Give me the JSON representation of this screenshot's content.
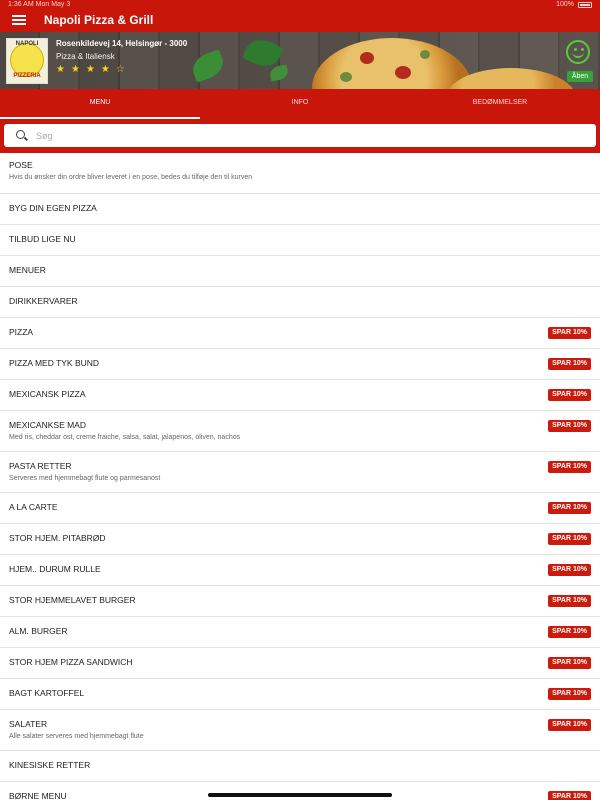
{
  "status_bar": {
    "time": "1:36 AM  Mon May 3",
    "battery": "100%"
  },
  "app_bar": {
    "title": "Napoli Pizza & Grill"
  },
  "restaurant": {
    "logo_text_top": "NAPOLI",
    "logo_text_bottom": "PIZZERIA",
    "address": "Rosenkildevej 14, Helsingør - 3000",
    "cuisine": "Pizza & Italiensk",
    "rating": {
      "filled": 4,
      "total": 5
    },
    "stars": [
      "★",
      "★",
      "★",
      "★",
      "☆"
    ],
    "status": "Åben"
  },
  "tabs": [
    {
      "label": "MENU",
      "active": true
    },
    {
      "label": "INFO",
      "active": false
    },
    {
      "label": "BEDØMMELSER",
      "active": false
    }
  ],
  "search": {
    "placeholder": "Søg"
  },
  "menu": [
    {
      "name": "POSE",
      "desc": "Hvis du ønsker din ordre bliver leveret i en pose, bedes du tilføje den til kurven",
      "badge": ""
    },
    {
      "name": "BYG DIN EGEN PIZZA",
      "desc": "",
      "badge": ""
    },
    {
      "name": "TILBUD LIGE NU",
      "desc": "",
      "badge": ""
    },
    {
      "name": "MENUER",
      "desc": "",
      "badge": ""
    },
    {
      "name": "DIRIKKERVARER",
      "desc": "",
      "badge": ""
    },
    {
      "name": "PIZZA",
      "desc": "",
      "badge": "SPAR 10%"
    },
    {
      "name": "PIZZA MED TYK BUND",
      "desc": "",
      "badge": "SPAR 10%"
    },
    {
      "name": "MEXICANSK PIZZA",
      "desc": "",
      "badge": "SPAR 10%"
    },
    {
      "name": "MEXICANKSE MAD",
      "desc": "Med ris, cheddar ost, creme fraiche, salsa, salat, jalapenos, oliven, nachos",
      "badge": "SPAR 10%"
    },
    {
      "name": "PASTA RETTER",
      "desc": "Serveres med hjemmebagt flute og parmesanost",
      "badge": "SPAR 10%"
    },
    {
      "name": "A LA CARTE",
      "desc": "",
      "badge": "SPAR 10%"
    },
    {
      "name": "STOR HJEM. PITABRØD",
      "desc": "",
      "badge": "SPAR 10%"
    },
    {
      "name": "HJEM.. DURUM RULLE",
      "desc": "",
      "badge": "SPAR 10%"
    },
    {
      "name": "STOR HJEMMELAVET BURGER",
      "desc": "",
      "badge": "SPAR 10%"
    },
    {
      "name": "ALM. BURGER",
      "desc": "",
      "badge": "SPAR 10%"
    },
    {
      "name": "STOR HJEM PIZZA SANDWICH",
      "desc": "",
      "badge": "SPAR 10%"
    },
    {
      "name": "BAGT KARTOFFEL",
      "desc": "",
      "badge": "SPAR 10%"
    },
    {
      "name": "SALATER",
      "desc": "Alle salater serveres med hjemmebagt flute",
      "badge": "SPAR 10%"
    },
    {
      "name": "KINESISKE RETTER",
      "desc": "",
      "badge": ""
    },
    {
      "name": "BØRNE MENU",
      "desc": "",
      "badge": "SPAR 10%"
    }
  ],
  "colors": {
    "brand_red": "#c8170a",
    "badge_red": "#cc1b0d",
    "open_green": "#35a33a",
    "star_yellow": "#f6d21b"
  }
}
